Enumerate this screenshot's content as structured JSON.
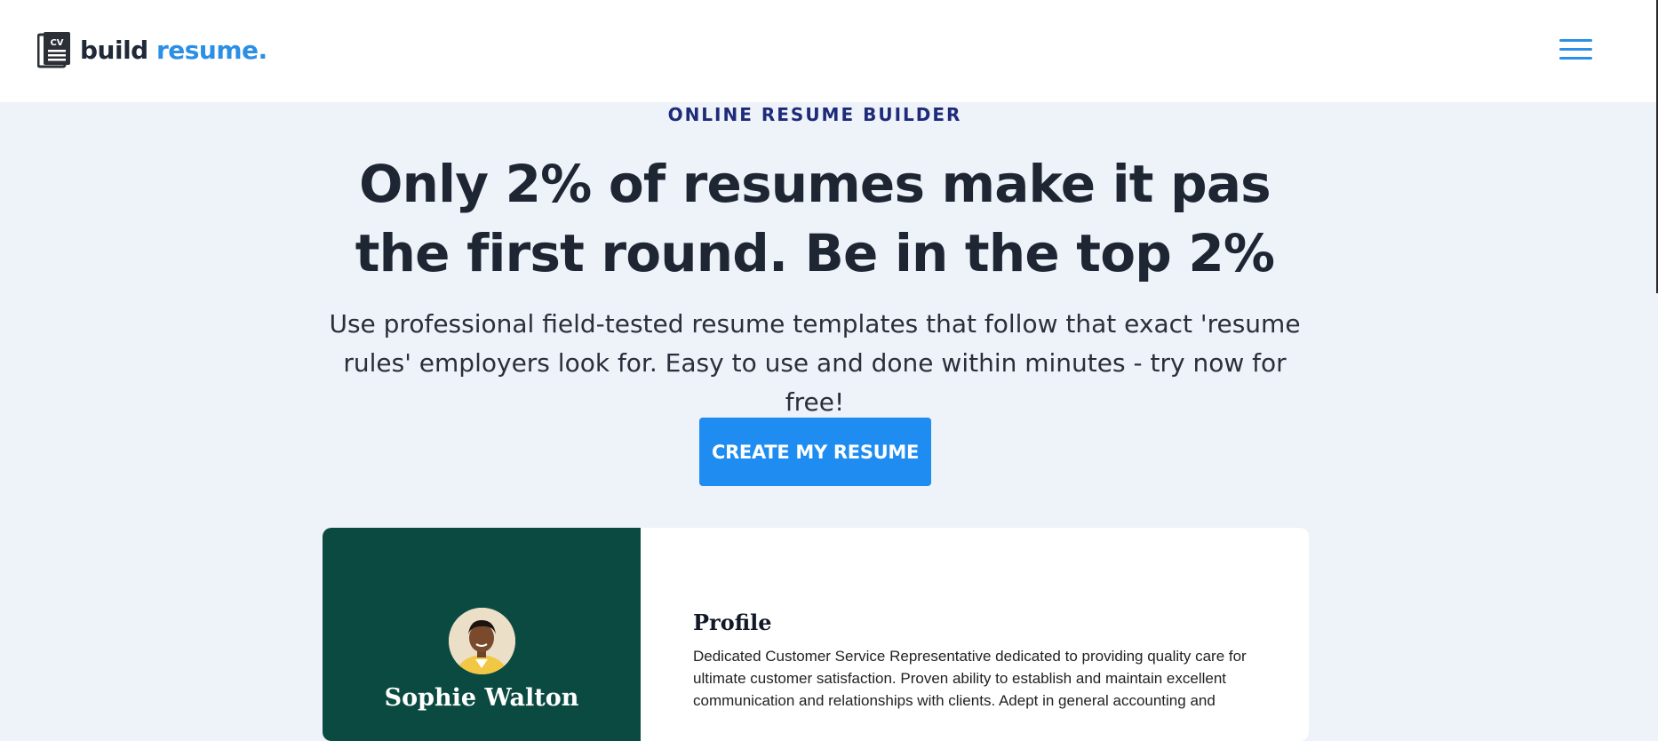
{
  "header": {
    "logo_icon": "cv-document-icon",
    "logo_icon_text": "CV",
    "logo_word_1": "build",
    "logo_word_2": "resume.",
    "menu_icon": "hamburger-menu-icon",
    "accent_color": "#2b8fe6"
  },
  "hero": {
    "eyebrow": "ONLINE RESUME BUILDER",
    "headline": "Only 2% of resumes make it pas the first round. Be in the top 2%",
    "subtitle": "Use professional field-tested resume templates that follow that exact 'resume rules' employers look for. Easy to use and done within minutes - try now for free!",
    "cta_label": "CREATE MY RESUME",
    "cta_color": "#1e8cf0"
  },
  "resume_preview": {
    "sidebar_color": "#0b4a40",
    "avatar_icon": "profile-photo",
    "name": "Sophie Walton",
    "profile_heading": "Profile",
    "profile_text": "Dedicated Customer Service Representative dedicated to providing quality care for ultimate customer satisfaction. Proven ability to establish and maintain excellent communication and relationships with clients. Adept in general accounting and"
  }
}
